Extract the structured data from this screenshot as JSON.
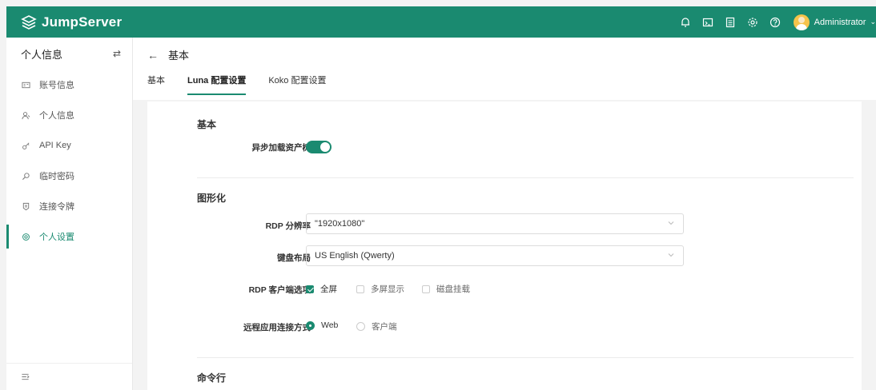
{
  "app": {
    "logo_text": "JumpServer",
    "user_name": "Administrator"
  },
  "topbar": {
    "icons": [
      "bell-icon",
      "terminal-icon",
      "tasks-icon",
      "gear-icon",
      "help-icon"
    ]
  },
  "sidebar": {
    "title": "个人信息",
    "toggle": "⇄",
    "items": [
      {
        "label": "账号信息",
        "icon": "id-card-icon"
      },
      {
        "label": "个人信息",
        "icon": "user-icon"
      },
      {
        "label": "API Key",
        "icon": "key-icon"
      },
      {
        "label": "临时密码",
        "icon": "search-key-icon"
      },
      {
        "label": "连接令牌",
        "icon": "token-icon"
      },
      {
        "label": "个人设置",
        "icon": "settings-icon",
        "active": true
      }
    ]
  },
  "page": {
    "back_arrow": "←",
    "title": "基本",
    "tabs": [
      {
        "label": "基本",
        "active": false
      },
      {
        "label": "Luna 配置设置",
        "active": true
      },
      {
        "label": "Koko 配置设置",
        "active": false
      }
    ]
  },
  "form": {
    "sections": {
      "basic": "基本",
      "graphics": "图形化",
      "command_line": "命令行"
    },
    "async_tree_label": "异步加载资产树",
    "async_tree_on": true,
    "rdp_resolution_label": "RDP 分辨率",
    "rdp_resolution_value": "\"1920x1080\"",
    "keyboard_label": "键盘布局",
    "keyboard_value": "US English (Qwerty)",
    "rdp_client_label": "RDP 客户端选项",
    "rdp_client_options": [
      {
        "label": "全屏",
        "checked": true
      },
      {
        "label": "多屏显示",
        "checked": false
      },
      {
        "label": "磁盘挂载",
        "checked": false
      }
    ],
    "remote_app_label": "远程应用连接方式",
    "remote_app_options": [
      {
        "label": "Web",
        "checked": true
      },
      {
        "label": "客户端",
        "checked": false
      }
    ]
  },
  "colors": {
    "brand": "#1a8a70"
  }
}
